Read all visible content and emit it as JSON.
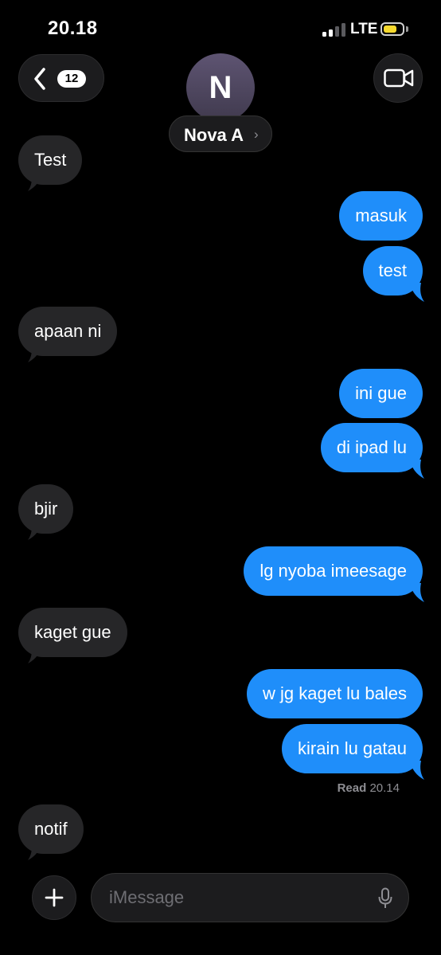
{
  "status_bar": {
    "time": "20.18",
    "network": "LTE",
    "battery_color": "#f5d92e",
    "battery_level": 0.72
  },
  "nav": {
    "unread_count": "12"
  },
  "contact": {
    "initial": "N",
    "name": "Nova A",
    "chevron": "›",
    "avatar_color": "#5a5070"
  },
  "messages": [
    {
      "text": "Test",
      "direction": "incoming"
    },
    {
      "text": "masuk",
      "direction": "outgoing"
    },
    {
      "text": "test",
      "direction": "outgoing"
    },
    {
      "text": "apaan ni",
      "direction": "incoming"
    },
    {
      "text": "ini gue",
      "direction": "outgoing"
    },
    {
      "text": "di ipad lu",
      "direction": "outgoing"
    },
    {
      "text": "bjir",
      "direction": "incoming"
    },
    {
      "text": "lg nyoba imeesage",
      "direction": "outgoing"
    },
    {
      "text": "kaget gue",
      "direction": "incoming"
    },
    {
      "text": "w jg kaget lu bales",
      "direction": "outgoing"
    },
    {
      "text": "kirain lu gatau",
      "direction": "outgoing"
    },
    {
      "text": "notif",
      "direction": "incoming"
    }
  ],
  "read_receipt": {
    "label": "Read",
    "time": "20.14"
  },
  "composer": {
    "placeholder": "iMessage"
  },
  "icons": {
    "back": "chevron-left-icon",
    "video": "video-camera-icon",
    "add": "plus-icon",
    "mic": "microphone-icon",
    "signal": "signal-bars-icon",
    "battery": "battery-icon"
  },
  "colors": {
    "outgoing_bubble": "#1f8efa",
    "incoming_bubble": "#262628",
    "background": "#000000"
  }
}
